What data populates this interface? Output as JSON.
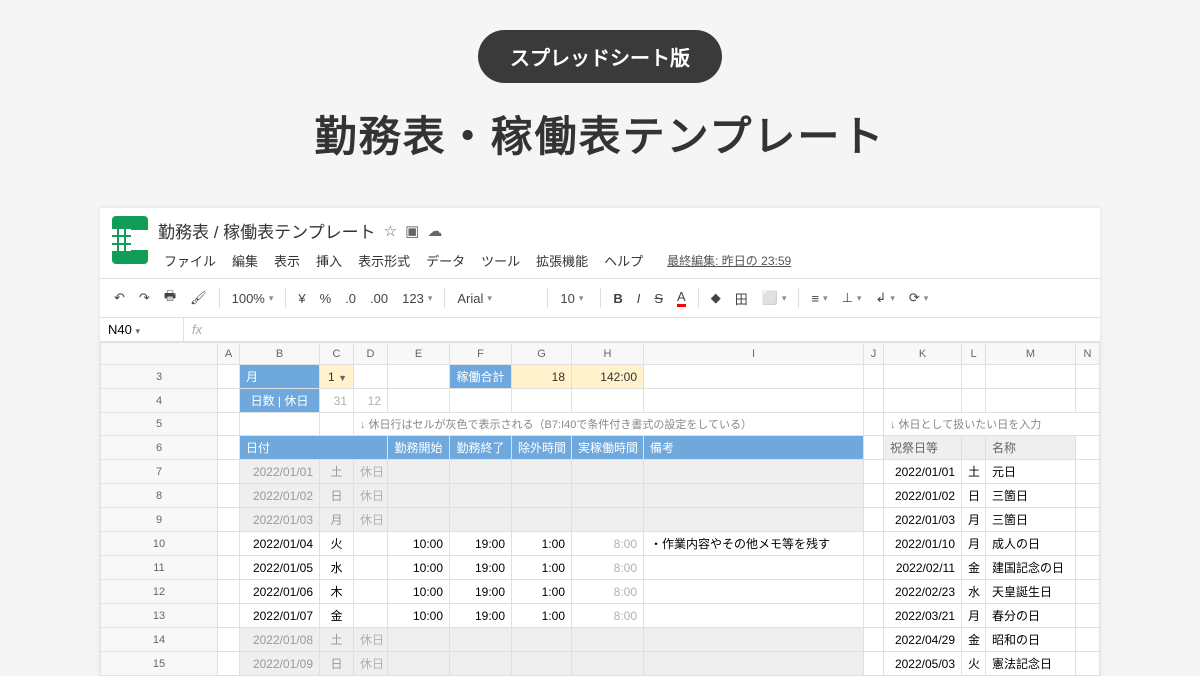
{
  "hero": {
    "badge": "スプレッドシート版",
    "title": "勤務表・稼働表テンプレート"
  },
  "doc": {
    "title": "勤務表 / 稼働表テンプレート",
    "lastEdit": "最終編集: 昨日の 23:59"
  },
  "menu": [
    "ファイル",
    "編集",
    "表示",
    "挿入",
    "表示形式",
    "データ",
    "ツール",
    "拡張機能",
    "ヘルプ"
  ],
  "toolbar": {
    "zoom": "100%",
    "fmt": "123",
    "font": "Arial",
    "size": "10",
    "currency": "¥",
    "percent": "%",
    "dec0": ".0",
    "dec00": ".00"
  },
  "namebox": "N40",
  "cols": [
    "",
    "A",
    "B",
    "C",
    "D",
    "E",
    "F",
    "G",
    "H",
    "I",
    "J",
    "K",
    "L",
    "M",
    "N"
  ],
  "hdr": {
    "month": "月",
    "monthVal": "1",
    "total": "稼働合計",
    "totalDays": "18",
    "totalHours": "142:00",
    "daysLabel": "日数 | 休日",
    "days": "31",
    "hol": "12",
    "note": "↓ 休日行はセルが灰色で表示される（B7:I40で条件付き書式の設定をしている）",
    "holNote": "↓ 休日として扱いたい日を入力",
    "date": "日付",
    "start": "勤務開始",
    "end": "勤務終了",
    "exclude": "除外時間",
    "actual": "実稼働時間",
    "remarks": "備考",
    "holHdr": "祝祭日等",
    "holName": "名称"
  },
  "rows": [
    {
      "n": "7",
      "d": "2022/01/01",
      "w": "土",
      "off": "休日",
      "hd": "2022/01/01",
      "hw": "土",
      "hn": "元日"
    },
    {
      "n": "8",
      "d": "2022/01/02",
      "w": "日",
      "off": "休日",
      "hd": "2022/01/02",
      "hw": "日",
      "hn": "三箇日"
    },
    {
      "n": "9",
      "d": "2022/01/03",
      "w": "月",
      "off": "休日",
      "hd": "2022/01/03",
      "hw": "月",
      "hn": "三箇日"
    },
    {
      "n": "10",
      "d": "2022/01/04",
      "w": "火",
      "s": "10:00",
      "e": "19:00",
      "ex": "1:00",
      "a": "8:00",
      "r": "・作業内容やその他メモ等を残す",
      "hd": "2022/01/10",
      "hw": "月",
      "hn": "成人の日"
    },
    {
      "n": "11",
      "d": "2022/01/05",
      "w": "水",
      "s": "10:00",
      "e": "19:00",
      "ex": "1:00",
      "a": "8:00",
      "hd": "2022/02/11",
      "hw": "金",
      "hn": "建国記念の日"
    },
    {
      "n": "12",
      "d": "2022/01/06",
      "w": "木",
      "s": "10:00",
      "e": "19:00",
      "ex": "1:00",
      "a": "8:00",
      "hd": "2022/02/23",
      "hw": "水",
      "hn": "天皇誕生日"
    },
    {
      "n": "13",
      "d": "2022/01/07",
      "w": "金",
      "s": "10:00",
      "e": "19:00",
      "ex": "1:00",
      "a": "8:00",
      "hd": "2022/03/21",
      "hw": "月",
      "hn": "春分の日"
    },
    {
      "n": "14",
      "d": "2022/01/08",
      "w": "土",
      "off": "休日",
      "hd": "2022/04/29",
      "hw": "金",
      "hn": "昭和の日"
    },
    {
      "n": "15",
      "d": "2022/01/09",
      "w": "日",
      "off": "休日",
      "hd": "2022/05/03",
      "hw": "火",
      "hn": "憲法記念日"
    }
  ]
}
